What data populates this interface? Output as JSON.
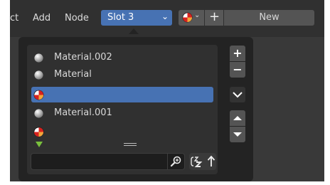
{
  "header": {
    "menu": [
      "ct",
      "Add",
      "Node"
    ],
    "slot_selector": {
      "value": "Slot 3"
    },
    "material_browse_icon": "material-sphere-icon",
    "new_button_label": "New"
  },
  "material_slots": [
    {
      "name": "Material.002",
      "icon": "material-ball-icon",
      "selected": false
    },
    {
      "name": "Material",
      "icon": "material-ball-icon",
      "selected": false
    },
    {
      "name": "",
      "icon": "material-sphere-icon",
      "selected": true
    },
    {
      "name": "Material.001",
      "icon": "material-ball-icon",
      "selected": false
    },
    {
      "name": "",
      "icon": "material-sphere-icon",
      "selected": false
    }
  ],
  "filter": {
    "search_value": ""
  },
  "side_buttons": [
    "+",
    "−"
  ],
  "colors": {
    "accent": "#4772b3",
    "panel_bg": "#232323",
    "list_bg": "#303030",
    "window_bg": "#393939",
    "header_bg": "#303030",
    "filter_toggle": "#7ac13d"
  }
}
